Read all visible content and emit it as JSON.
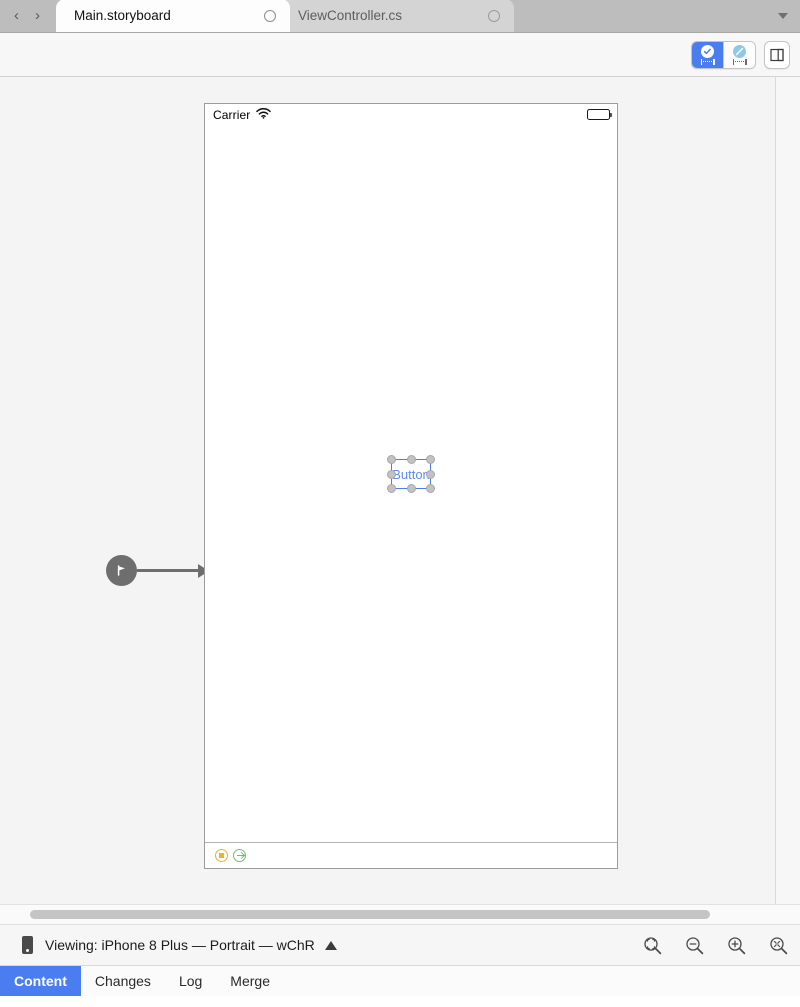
{
  "tabbar": {
    "nav": {
      "back": "‹",
      "forward": "›"
    },
    "tabs": [
      {
        "label": "Main.storyboard",
        "active": true,
        "close": ""
      },
      {
        "label": "ViewController.cs",
        "active": false,
        "close": ""
      }
    ],
    "menu_caret": ""
  },
  "toolbar": {
    "segment_constraints_on": "",
    "segment_constraints_off": "",
    "panel_toggle": ""
  },
  "canvas": {
    "device": {
      "statusbar": {
        "carrier": "Carrier",
        "wifi": "",
        "battery": ""
      },
      "button": {
        "label": "Button"
      },
      "footer": {
        "view_controller_icon": "",
        "exit_icon": ""
      }
    },
    "entry_point": {
      "flag": ""
    }
  },
  "status": {
    "viewing_text": "Viewing: iPhone 8 Plus — Portrait — wChR",
    "device_icon": "",
    "expand_triangle": "",
    "zoom_controls": [
      {
        "name": "zoom-to-fit"
      },
      {
        "name": "zoom-out"
      },
      {
        "name": "zoom-in"
      },
      {
        "name": "zoom-actual-size"
      }
    ]
  },
  "bottom_tabs": [
    {
      "label": "Content",
      "active": true
    },
    {
      "label": "Changes",
      "active": false
    },
    {
      "label": "Log",
      "active": false
    },
    {
      "label": "Merge",
      "active": false
    }
  ],
  "colors": {
    "accent": "#4a7ef0",
    "tabbar_bg": "#bdbdbd",
    "toolbar_bg": "#f7f7f7",
    "canvas_bg": "#f4f4f4",
    "entry_point": "#6e6e6e"
  }
}
